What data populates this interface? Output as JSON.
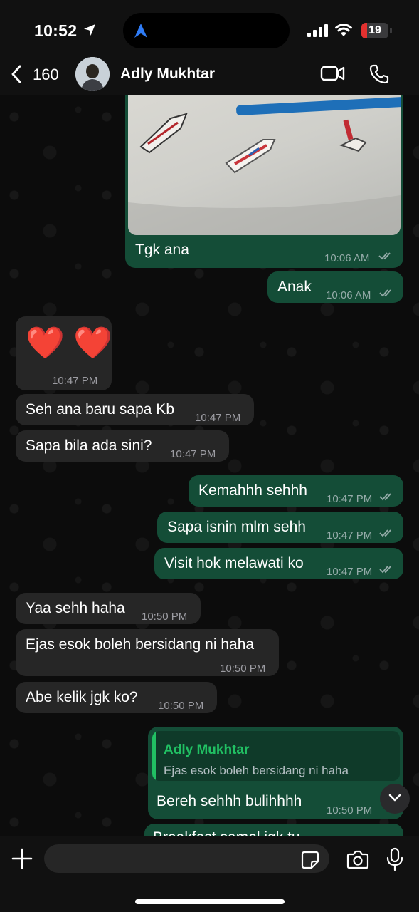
{
  "status_bar": {
    "time": "10:52",
    "battery": "19"
  },
  "header": {
    "back_count": "160",
    "contact_name": "Adly Mukhtar"
  },
  "messages": [
    {
      "text": "Tgk ana",
      "time": "10:06 AM"
    },
    {
      "text": "Anak",
      "time": "10:06 AM"
    },
    {
      "text": "❤️ ❤️",
      "time": "10:47 PM"
    },
    {
      "text": "Seh ana baru sapa Kb",
      "time": "10:47 PM"
    },
    {
      "text": "Sapa bila ada sini?",
      "time": "10:47 PM"
    },
    {
      "text": "Kemahhh sehhh",
      "time": "10:47 PM"
    },
    {
      "text": "Sapa isnin mlm sehh",
      "time": "10:47 PM"
    },
    {
      "text": "Visit hok melawati ko",
      "time": "10:47 PM"
    },
    {
      "text": "Yaa sehh haha",
      "time": "10:50 PM"
    },
    {
      "text": "Ejas esok boleh bersidang ni haha",
      "time": "10:50 PM"
    },
    {
      "text": "Abe kelik jgk ko?",
      "time": "10:50 PM"
    },
    {
      "text": "Bereh sehhh bulihhhh",
      "time": "10:50 PM",
      "quote_name": "Adly Mukhtar",
      "quote_text": "Ejas esok boleh bersidang ni haha"
    },
    {
      "text": "Breakfast samel jgk tu"
    }
  ],
  "input": {
    "placeholder": ""
  },
  "colors": {
    "outgoing": "#144d37",
    "incoming": "#262626",
    "accent": "#21c063"
  }
}
